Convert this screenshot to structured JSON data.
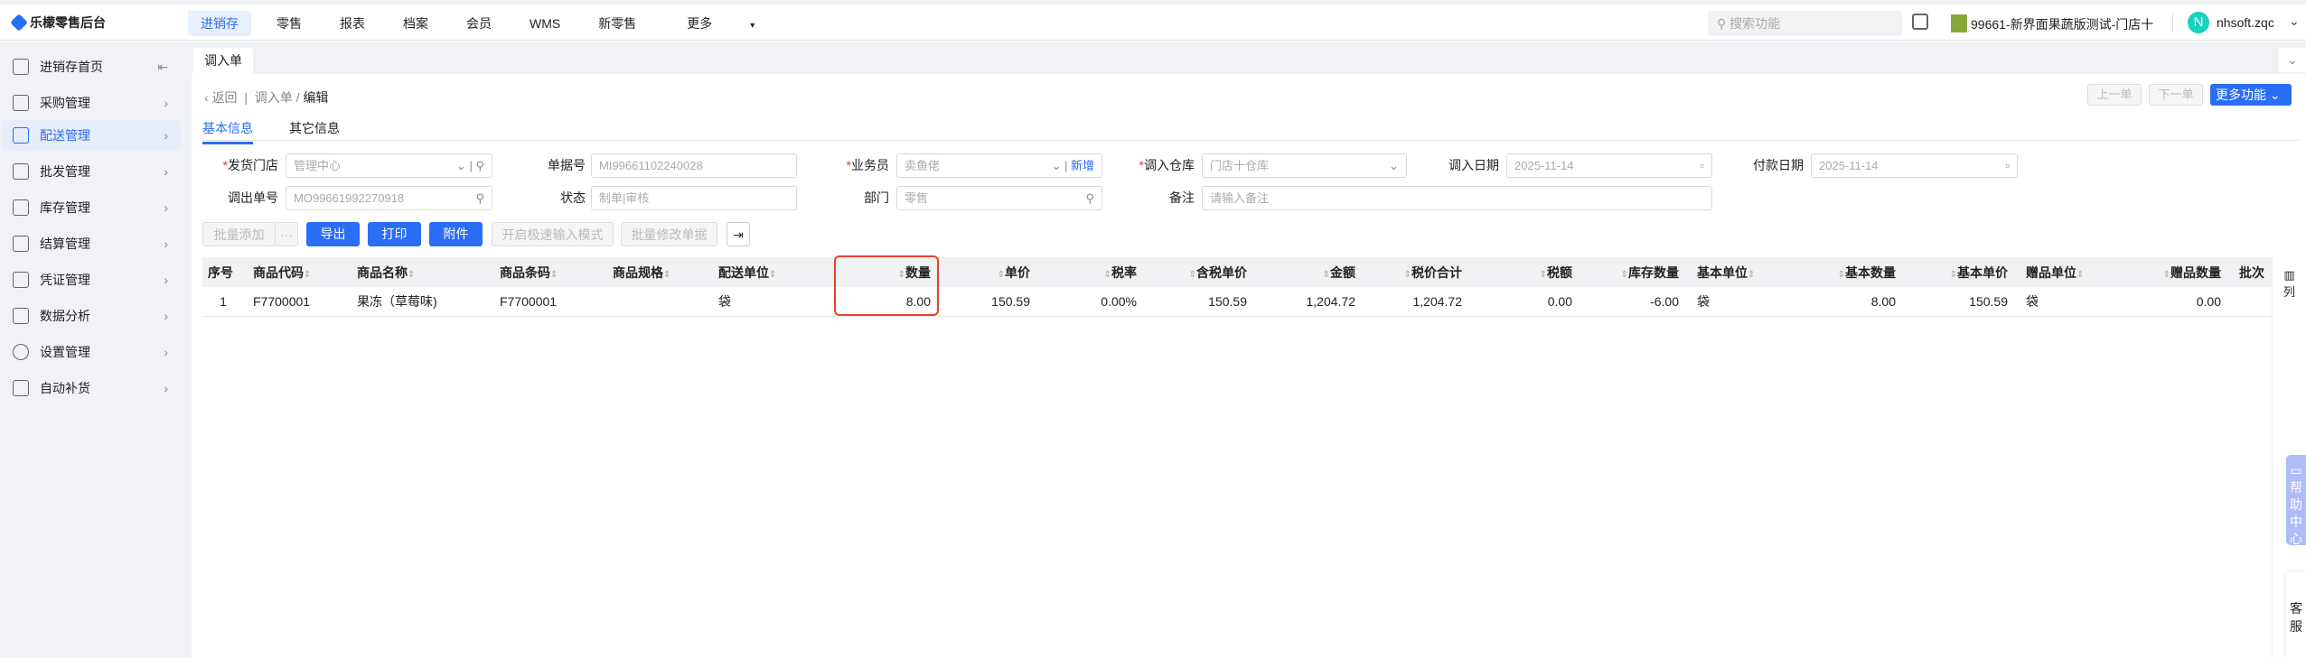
{
  "app": {
    "title": "乐檬零售后台"
  },
  "nav": {
    "items": [
      "进销存",
      "零售",
      "报表",
      "档案",
      "会员",
      "WMS",
      "新零售",
      "更多"
    ],
    "active": "进销存",
    "more_arrow": "▾"
  },
  "header": {
    "search_placeholder": "搜索功能",
    "store": "99661-新界面果蔬版测试-门店十",
    "avatar_letter": "N",
    "user": "nhsoft.zqc"
  },
  "sidebar": {
    "items": [
      {
        "label": "进销存首页"
      },
      {
        "label": "采购管理"
      },
      {
        "label": "配送管理",
        "active": true
      },
      {
        "label": "批发管理"
      },
      {
        "label": "库存管理"
      },
      {
        "label": "结算管理"
      },
      {
        "label": "凭证管理"
      },
      {
        "label": "数据分析"
      },
      {
        "label": "设置管理"
      },
      {
        "label": "自动补货"
      }
    ]
  },
  "page_tab": "调入单",
  "breadcrumb": {
    "back": "返回",
    "parent": "调入单",
    "current": "编辑"
  },
  "top_actions": {
    "prev": "上一单",
    "next": "下一单",
    "more": "更多功能"
  },
  "subtabs": [
    "基本信息",
    "其它信息"
  ],
  "form": {
    "send_store": {
      "label": "发货门店",
      "value": "管理中心"
    },
    "doc_no": {
      "label": "单据号",
      "value": "MI99661102240028"
    },
    "clerk": {
      "label": "业务员",
      "value": "卖鱼佬",
      "add": "新增"
    },
    "in_warehouse": {
      "label": "调入仓库",
      "value": "门店十仓库"
    },
    "in_date": {
      "label": "调入日期",
      "value": "2025-11-14"
    },
    "pay_date": {
      "label": "付款日期",
      "value": "2025-11-14"
    },
    "out_no": {
      "label": "调出单号",
      "value": "MO99661992270918"
    },
    "status": {
      "label": "状态",
      "value": "制单|审核"
    },
    "dept": {
      "label": "部门",
      "value": "零售"
    },
    "remark": {
      "label": "备注",
      "placeholder": "请输入备注"
    }
  },
  "toolbar": {
    "batch_add": "批量添加",
    "more": "···",
    "export": "导出",
    "print": "打印",
    "attach": "附件",
    "fast_mode": "开启极速输入模式",
    "batch_edit": "批量修改单据"
  },
  "table": {
    "headers": [
      "序号",
      "商品代码",
      "商品名称",
      "商品条码",
      "商品规格",
      "配送单位",
      "数量",
      "单价",
      "税率",
      "含税单价",
      "金额",
      "税价合计",
      "税额",
      "库存数量",
      "基本单位",
      "基本数量",
      "基本单价",
      "赠品单位",
      "赠品数量",
      "批次"
    ],
    "rows": [
      [
        "1",
        "F7700001",
        "果冻（草莓味)",
        "F7700001",
        "",
        "袋",
        "8.00",
        "150.59",
        "0.00%",
        "150.59",
        "1,204.72",
        "1,204.72",
        "0.00",
        "-6.00",
        "袋",
        "8.00",
        "150.59",
        "袋",
        "0.00",
        ""
      ]
    ]
  },
  "column_settings": "列",
  "help_center": "帮助中心",
  "customer_service": "客服"
}
